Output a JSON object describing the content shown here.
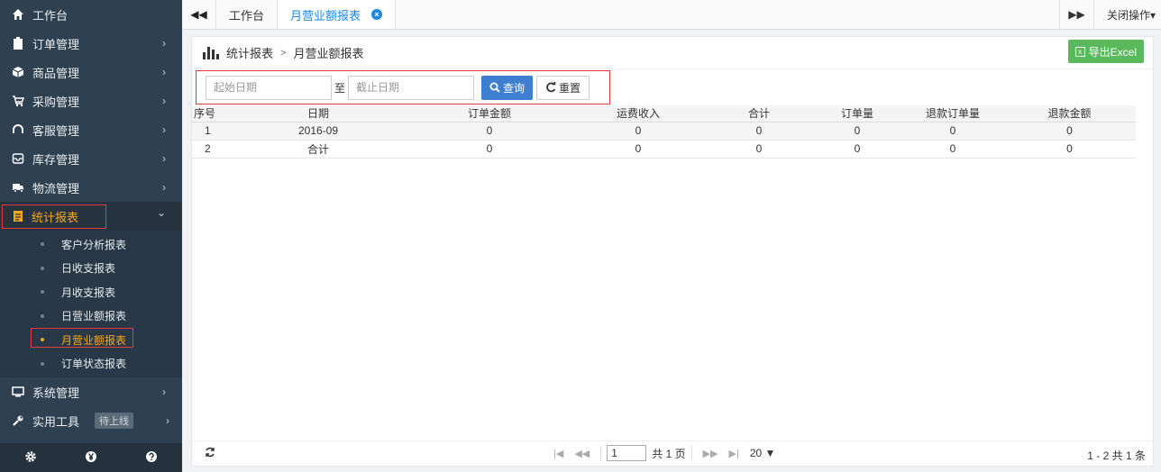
{
  "sidebar": {
    "items": [
      {
        "label": "工作台",
        "icon": "home-icon",
        "arrow": ""
      },
      {
        "label": "订单管理",
        "icon": "clipboard-icon",
        "arrow": "›"
      },
      {
        "label": "商品管理",
        "icon": "cube-icon",
        "arrow": "›"
      },
      {
        "label": "采购管理",
        "icon": "cart-icon",
        "arrow": "›"
      },
      {
        "label": "客服管理",
        "icon": "headset-icon",
        "arrow": "›"
      },
      {
        "label": "库存管理",
        "icon": "inbox-icon",
        "arrow": "›"
      },
      {
        "label": "物流管理",
        "icon": "truck-icon",
        "arrow": "›"
      }
    ],
    "reports": {
      "label": "统计报表",
      "icon": "report-icon",
      "arrow": "⌄"
    },
    "report_items": [
      {
        "label": "客户分析报表"
      },
      {
        "label": "日收支报表"
      },
      {
        "label": "月收支报表"
      },
      {
        "label": "日营业额报表"
      },
      {
        "label": "月营业额报表"
      },
      {
        "label": "订单状态报表"
      }
    ],
    "system": {
      "label": "系统管理",
      "arrow": "›"
    },
    "tools": {
      "label": "实用工具",
      "badge": "待上线",
      "arrow": "›"
    },
    "footer_icons": [
      "gear-icon",
      "yen-icon",
      "help-icon"
    ]
  },
  "tabs": {
    "back": "◀◀",
    "items": [
      {
        "label": "工作台"
      },
      {
        "label": "月营业额报表"
      }
    ],
    "forward": "▶▶",
    "close_ops": "关闭操作▾"
  },
  "panel": {
    "breadcrumb_root": "统计报表",
    "breadcrumb_sep": ">",
    "breadcrumb_current": "月营业额报表",
    "export_label": "导出Excel"
  },
  "search": {
    "start_placeholder": "起始日期",
    "to_label": "至",
    "end_placeholder": "截止日期",
    "query_label": "查询",
    "reset_label": "重置"
  },
  "table": {
    "columns": [
      "序号",
      "日期",
      "订单金额",
      "运费收入",
      "合计",
      "订单量",
      "退款订单量",
      "退款金额"
    ],
    "rows": [
      [
        "1",
        "2016-09",
        "0",
        "0",
        "0",
        "0",
        "0",
        "0"
      ],
      [
        "2",
        "合计",
        "0",
        "0",
        "0",
        "0",
        "0",
        "0"
      ]
    ]
  },
  "pager": {
    "page": "1",
    "total_pages": "共 1 页",
    "page_size": "20 ▼",
    "info": "1 - 2 共 1 条"
  },
  "colors": {
    "sidebar_bg": "#2f4050",
    "active": "#f4a91c",
    "highlight_border": "#e0393e",
    "primary": "#3f7fd1",
    "export": "#5cb85c"
  }
}
